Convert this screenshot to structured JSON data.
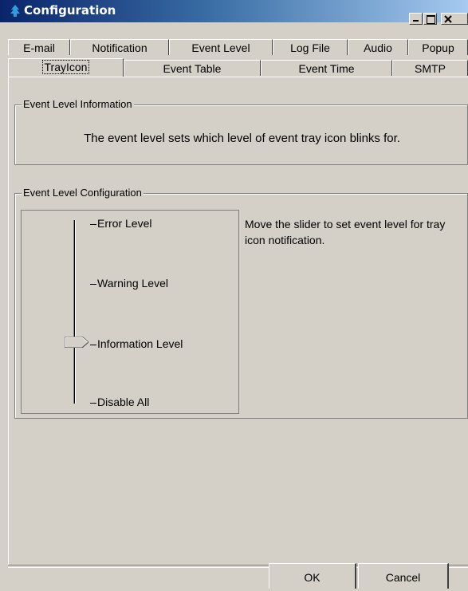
{
  "window": {
    "title": "Configuration"
  },
  "tabs": {
    "top_row": [
      "E-mail",
      "Notification",
      "Event Level",
      "Log File",
      "Audio",
      "Popup"
    ],
    "bottom_row": [
      "TrayIcon",
      "Event Table",
      "Event Time",
      "SMTP"
    ],
    "active": "TrayIcon"
  },
  "info_group": {
    "legend": "Event Level Information",
    "text": "The event level sets which level of event tray icon blinks for."
  },
  "config_group": {
    "legend": "Event Level Configuration",
    "levels": [
      "Error Level",
      "Warning Level",
      "Information Level",
      "Disable All"
    ],
    "selected_level": "Information Level",
    "help": "Move the slider to set event level for tray icon notification."
  },
  "buttons": {
    "ok": "OK",
    "cancel": "Cancel"
  }
}
